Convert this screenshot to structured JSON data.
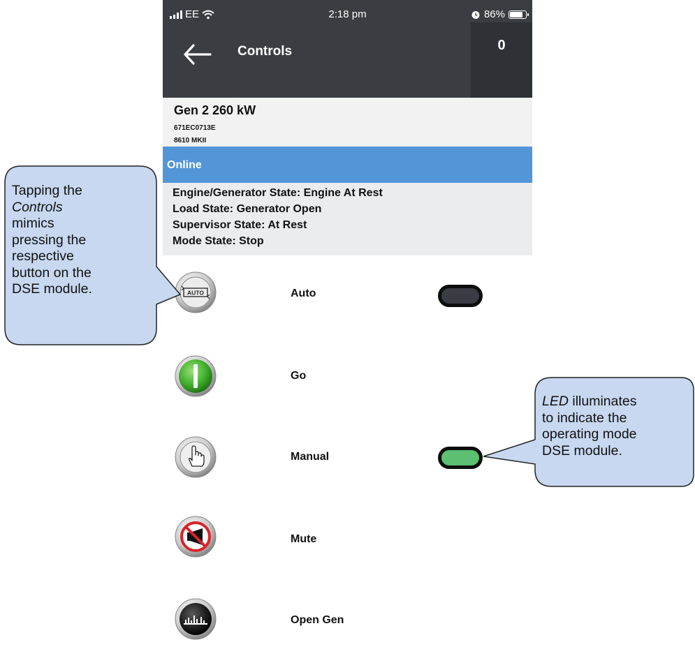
{
  "statusbar": {
    "carrier": "EE",
    "time": "2:18 pm",
    "battery": "86%",
    "battery_level": 0.86,
    "icons": [
      "signal-icon",
      "wifi-icon",
      "alarm-icon",
      "battery-icon"
    ]
  },
  "header": {
    "title": "Controls",
    "counter": "0",
    "back_icon": "back-arrow-icon"
  },
  "device": {
    "name": "Gen 2 260 kW",
    "serial": "671EC0713E",
    "model": "8610 MKII"
  },
  "status": {
    "connection": "Online"
  },
  "states": [
    "Engine/Generator State: Engine At Rest",
    "Load State: Generator Open",
    "Supervisor State: At Rest",
    "Mode State: Stop"
  ],
  "controls": [
    {
      "label": "Auto",
      "icon": "auto-mode-icon",
      "led": "off"
    },
    {
      "label": "Go",
      "icon": "start-icon",
      "led": "none"
    },
    {
      "label": "Manual",
      "icon": "manual-hand-icon",
      "led": "on"
    },
    {
      "label": "Mute",
      "icon": "mute-horn-icon",
      "led": "none"
    },
    {
      "label": "Open Gen",
      "icon": "open-generator-icon",
      "led": "none"
    }
  ],
  "colors": {
    "header": "#3a3d42",
    "online_bar": "#5296d8",
    "led_on": "#5cbf72",
    "led_off": "#3a3c44",
    "callout_fill": "#c7d8f0"
  },
  "callouts": {
    "left": {
      "line1": "Tapping the",
      "line2_em": "Controls",
      "line3": "mimics",
      "line4": "pressing the",
      "line5": "respective",
      "line6": "button on the",
      "line7": "DSE module."
    },
    "right": {
      "line1_em": "LED",
      "line1_rest": " illuminates",
      "line2": "to indicate the",
      "line3": "operating mode",
      "line4": "DSE module."
    }
  }
}
